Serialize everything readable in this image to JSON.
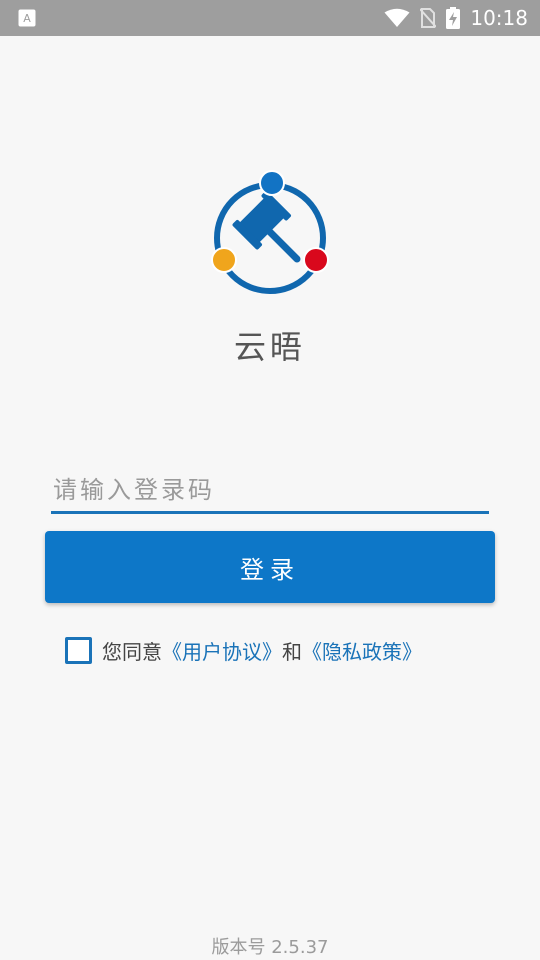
{
  "status_bar": {
    "time": "10:18"
  },
  "app": {
    "name": "云晤"
  },
  "login": {
    "code_placeholder": "请输入登录码",
    "login_label": "登录"
  },
  "agreement": {
    "prefix": "您同意",
    "user_agreement": "《用户协议》",
    "conjunction": "和",
    "privacy_policy": "《隐私政策》"
  },
  "footer": {
    "version": "版本号 2.5.37"
  },
  "colors": {
    "primary": "#0d77c8",
    "accent_blue": "#1273c4",
    "accent_orange": "#f0a51c",
    "accent_red": "#d9081c",
    "status_bar": "#9e9e9e"
  }
}
